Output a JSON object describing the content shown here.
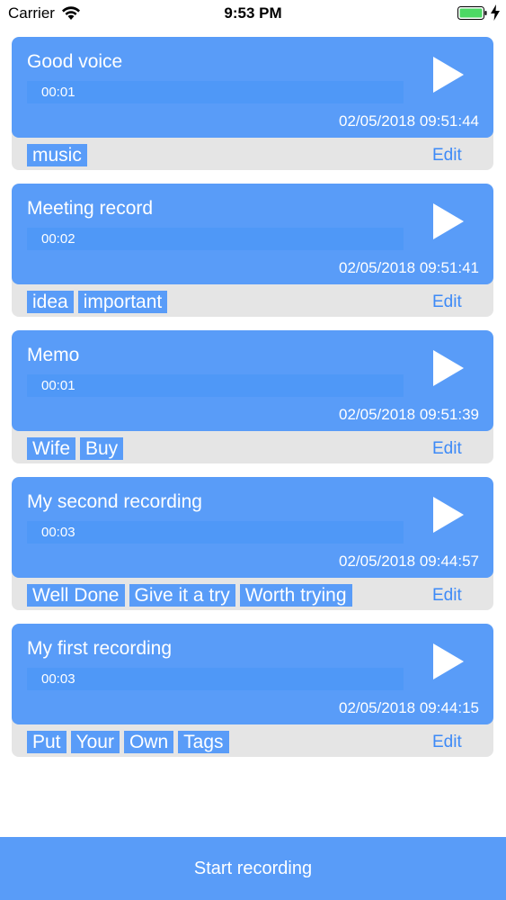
{
  "status_bar": {
    "carrier": "Carrier",
    "time": "9:53 PM",
    "battery_color": "#4cd964"
  },
  "colors": {
    "card_blue": "#599cf8",
    "tag_strip": "#e5e5e5",
    "edit_blue": "#3d8af7"
  },
  "recordings": [
    {
      "title": "Good voice",
      "duration": "00:01",
      "date": "02/05/2018 09:51:44",
      "tags": [
        "music"
      ],
      "edit_label": "Edit"
    },
    {
      "title": "Meeting record",
      "duration": "00:02",
      "date": "02/05/2018 09:51:41",
      "tags": [
        "idea",
        "important"
      ],
      "edit_label": "Edit"
    },
    {
      "title": "Memo",
      "duration": "00:01",
      "date": "02/05/2018 09:51:39",
      "tags": [
        "Wife",
        "Buy"
      ],
      "edit_label": "Edit"
    },
    {
      "title": "My second recording",
      "duration": "00:03",
      "date": "02/05/2018 09:44:57",
      "tags": [
        "Well Done",
        "Give it a try",
        "Worth trying"
      ],
      "edit_label": "Edit"
    },
    {
      "title": "My first recording",
      "duration": "00:03",
      "date": "02/05/2018 09:44:15",
      "tags": [
        "Put",
        "Your",
        "Own",
        "Tags"
      ],
      "edit_label": "Edit"
    }
  ],
  "footer": {
    "start_label": "Start recording"
  }
}
